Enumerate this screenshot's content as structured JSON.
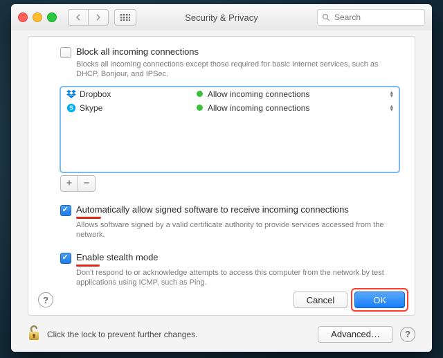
{
  "window": {
    "title": "Security & Privacy"
  },
  "toolbar": {
    "search_placeholder": "Search"
  },
  "block_all": {
    "checked": false,
    "label": "Block all incoming connections",
    "desc": "Blocks all incoming connections except those required for basic Internet services,  such as DHCP, Bonjour, and IPSec."
  },
  "apps": [
    {
      "icon": "dropbox-icon",
      "name": "Dropbox",
      "status": "Allow incoming connections"
    },
    {
      "icon": "skype-icon",
      "name": "Skype",
      "status": "Allow incoming connections"
    }
  ],
  "auto_allow": {
    "checked": true,
    "label": "Automatically allow signed software to receive incoming connections",
    "desc": "Allows software signed by a valid certificate authority to provide services accessed from the network.",
    "underline_width": 36
  },
  "stealth": {
    "checked": true,
    "label": "Enable stealth mode",
    "desc": "Don't respond to or acknowledge attempts to access this computer from the network by test applications using ICMP, such as Ping.",
    "underline_width": 34
  },
  "buttons": {
    "add": "+",
    "remove": "−",
    "cancel": "Cancel",
    "ok": "OK",
    "advanced": "Advanced…",
    "help": "?"
  },
  "lock_msg": "Click the lock to prevent further changes."
}
